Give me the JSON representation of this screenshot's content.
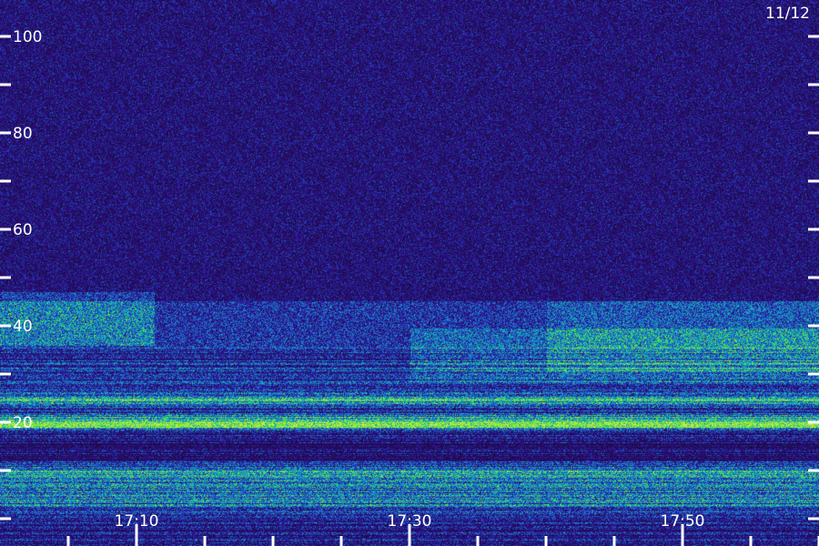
{
  "chart_data": {
    "type": "heatmap",
    "date_label": "11/12",
    "y_ticks": [
      {
        "value": 100,
        "label": "100"
      },
      {
        "value": 80,
        "label": "80"
      },
      {
        "value": 60,
        "label": "60"
      },
      {
        "value": 40,
        "label": "40"
      },
      {
        "value": 20,
        "label": "20"
      }
    ],
    "y_minor_ticks": [
      90,
      70,
      50,
      30,
      10,
      0
    ],
    "ylim": [
      0,
      102
    ],
    "x_ticks": [
      {
        "value": "17:10",
        "label": "17:10"
      },
      {
        "value": "17:30",
        "label": "17:30"
      },
      {
        "value": "17:50",
        "label": "17:50"
      }
    ],
    "x_minor_ticks": [
      "17:05",
      "17:15",
      "17:20",
      "17:25",
      "17:35",
      "17:40",
      "17:45",
      "17:55",
      "18:00"
    ],
    "xlim": [
      "17:00",
      "18:00"
    ],
    "colors": {
      "background": "#14104a",
      "low": "#2a1a8c",
      "mid": "#1a4ad0",
      "high": "#19c8b0",
      "peak": "#9cff3a",
      "tick": "#ffffff"
    }
  }
}
